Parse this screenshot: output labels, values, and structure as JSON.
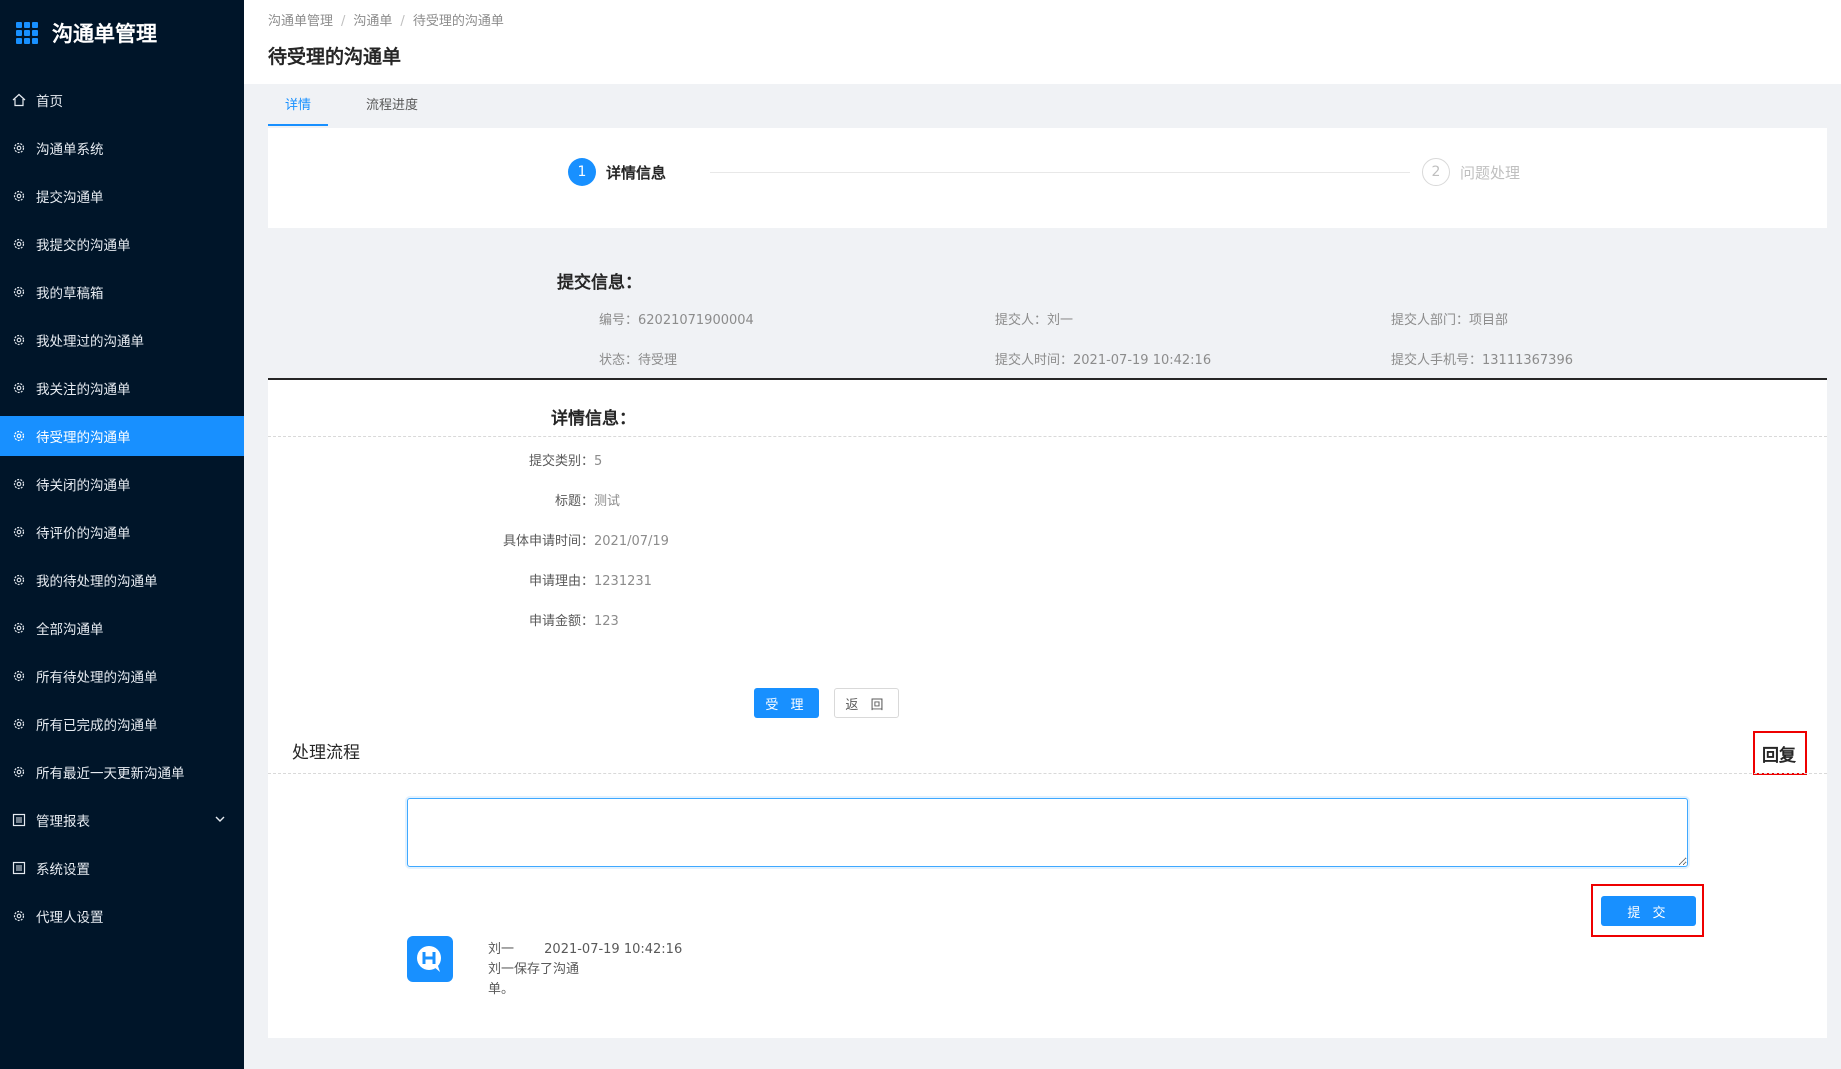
{
  "app": {
    "title": "沟通单管理"
  },
  "sidebar": {
    "items": [
      {
        "label": "首页",
        "icon": "home-icon"
      },
      {
        "label": "沟通单系统",
        "icon": "gear-icon"
      },
      {
        "label": "提交沟通单",
        "icon": "gear-icon"
      },
      {
        "label": "我提交的沟通单",
        "icon": "gear-icon"
      },
      {
        "label": "我的草稿箱",
        "icon": "gear-icon"
      },
      {
        "label": "我处理过的沟通单",
        "icon": "gear-icon"
      },
      {
        "label": "我关注的沟通单",
        "icon": "gear-icon"
      },
      {
        "label": "待受理的沟通单",
        "icon": "gear-icon",
        "active": true
      },
      {
        "label": "待关闭的沟通单",
        "icon": "gear-icon"
      },
      {
        "label": "待评价的沟通单",
        "icon": "gear-icon"
      },
      {
        "label": "我的待处理的沟通单",
        "icon": "gear-icon"
      },
      {
        "label": "全部沟通单",
        "icon": "gear-icon"
      },
      {
        "label": "所有待处理的沟通单",
        "icon": "gear-icon"
      },
      {
        "label": "所有已完成的沟通单",
        "icon": "gear-icon"
      },
      {
        "label": "所有最近一天更新沟通单",
        "icon": "gear-icon"
      },
      {
        "label": "管理报表",
        "icon": "list-icon",
        "has_submenu": true
      },
      {
        "label": "系统设置",
        "icon": "list-icon"
      },
      {
        "label": "代理人设置",
        "icon": "gear-icon"
      }
    ]
  },
  "breadcrumb": [
    "沟通单管理",
    "沟通单",
    "待受理的沟通单"
  ],
  "page_title": "待受理的沟通单",
  "tabs": [
    {
      "label": "详情",
      "active": true
    },
    {
      "label": "流程进度",
      "active": false
    }
  ],
  "steps": [
    {
      "number": "1",
      "label": "详情信息",
      "active": true
    },
    {
      "number": "2",
      "label": "问题处理",
      "active": false
    }
  ],
  "submit_info": {
    "title": "提交信息：",
    "number_label": "编号：",
    "number": "62021071900004",
    "submitter_label": "提交人：",
    "submitter": "刘一",
    "dept_label": "提交人部门：",
    "dept": "项目部",
    "status_label": "状态：",
    "status": "待受理",
    "time_label": "提交人时间：",
    "time": "2021-07-19 10:42:16",
    "phone_label": "提交人手机号：",
    "phone": "13111367396"
  },
  "detail_info": {
    "title": "详情信息：",
    "rows": [
      {
        "label": "提交类别：",
        "value": "5"
      },
      {
        "label": "标题：",
        "value": "测试"
      },
      {
        "label": "具体申请时间：",
        "value": "2021/07/19"
      },
      {
        "label": "申请理由：",
        "value": "1231231"
      },
      {
        "label": "申请金额：",
        "value": "123"
      }
    ]
  },
  "actions": {
    "accept": "受 理",
    "back": "返 回"
  },
  "process": {
    "title": "处理流程",
    "reply": "回复",
    "submit": "提 交",
    "reply_value": ""
  },
  "logs": [
    {
      "user": "刘一",
      "time": "2021-07-19 10:42:16",
      "text_line1": "刘一保存了沟通",
      "text_line2": "单。"
    }
  ],
  "colors": {
    "sidebar_bg": "#001529",
    "accent": "#1890ff",
    "highlight": "#ee0000"
  }
}
